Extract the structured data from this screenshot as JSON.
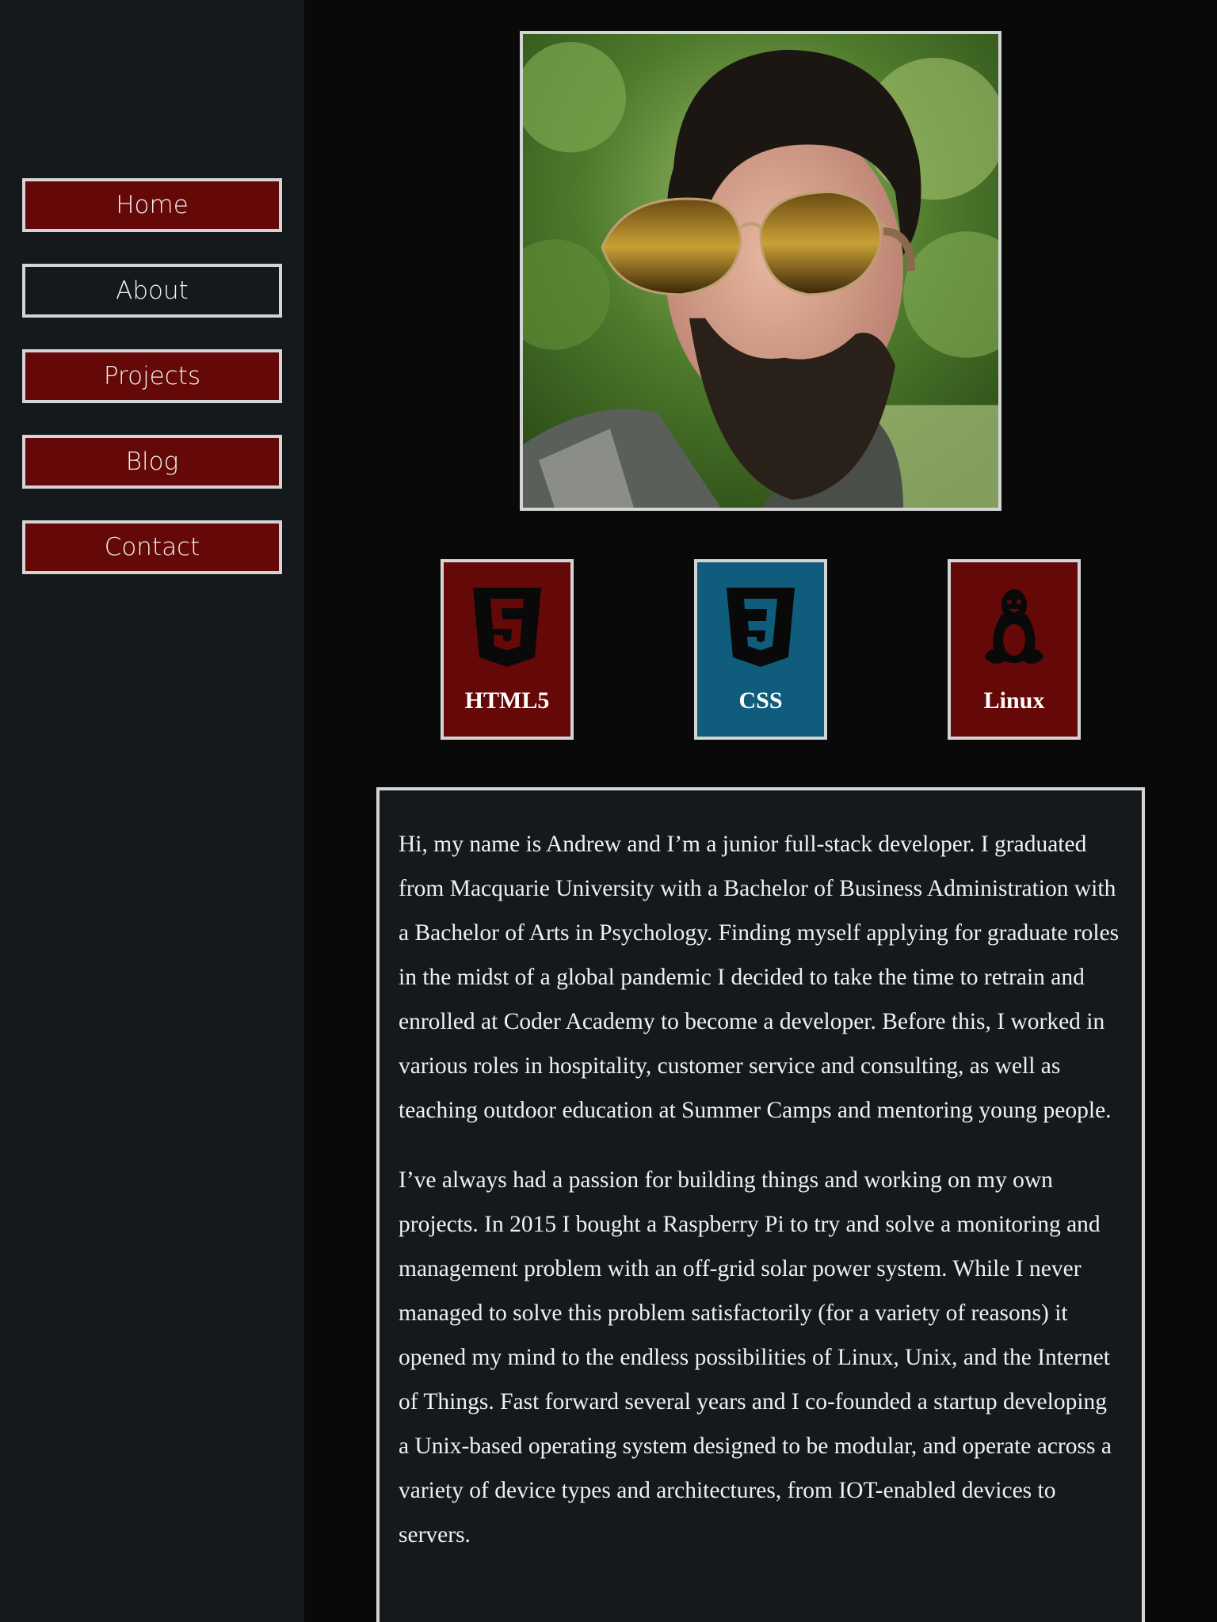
{
  "nav": {
    "items": [
      {
        "label": "Home",
        "active": false
      },
      {
        "label": "About",
        "active": true
      },
      {
        "label": "Projects",
        "active": false
      },
      {
        "label": "Blog",
        "active": false
      },
      {
        "label": "Contact",
        "active": false
      }
    ]
  },
  "profile_photo": {
    "icon": "portrait-photo"
  },
  "skills": [
    {
      "label": "HTML5",
      "icon": "html5-icon",
      "color": "#650808"
    },
    {
      "label": "CSS",
      "icon": "css3-icon",
      "color": "#0f5c7d"
    },
    {
      "label": "Linux",
      "icon": "linux-tux-icon",
      "color": "#650808"
    }
  ],
  "about": {
    "paragraphs": [
      "Hi, my name is Andrew and I’m a junior full-stack developer. I graduated from Macquarie University with a Bachelor of Business Administration with a Bachelor of Arts in Psychology. Finding myself applying for graduate roles in the midst of a global pandemic I decided to take the time to retrain and enrolled at Coder Academy to become a developer. Before this, I worked in various roles in hospitality, customer service and consulting, as well as teaching outdoor education at Summer Camps and mentoring young people.",
      "I’ve always had a passion for building things and working on my own projects. In 2015 I bought a Raspberry Pi to try and solve a monitoring and management problem with an off-grid solar power system. While I never managed to solve this problem satisfactorily (for a variety of reasons) it opened my mind to the endless possibilities of Linux, Unix, and the Internet of Things. Fast forward several years and I co-founded a startup developing a Unix-based operating system designed to be modular, and operate across a variety of device types and architectures, from IOT-enabled devices to servers."
    ]
  },
  "colors": {
    "sidebar_bg": "#16191c",
    "page_bg": "#0a090a",
    "accent_red": "#650808",
    "accent_blue": "#0f5c7d",
    "border": "#d4d4d4"
  }
}
